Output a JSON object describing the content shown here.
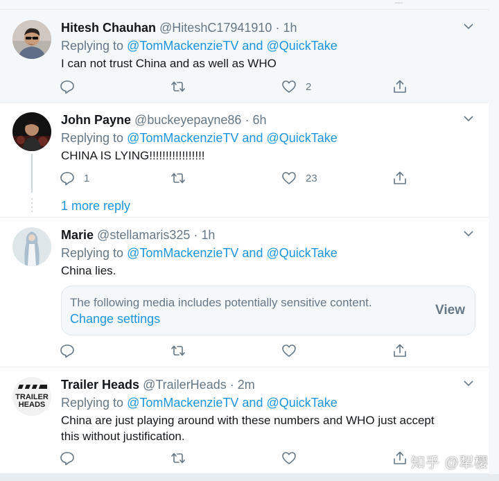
{
  "reply_prefix": "Replying to",
  "mention_1": "@TomMackenzieTV",
  "mention_join": "and",
  "mention_2": "@QuickTake",
  "header_sep": "·",
  "top_ghost": "—",
  "tweets": [
    {
      "name": "Hitesh Chauhan",
      "handle": "@HiteshC17941910",
      "time": "1h",
      "text": "I can not trust China and as well as WHO",
      "replies": "",
      "retweets": "",
      "likes": "2"
    },
    {
      "name": "John Payne",
      "handle": "@buckeyepayne86",
      "time": "6h",
      "text": "CHINA IS LYING!!!!!!!!!!!!!!!!!",
      "replies": "1",
      "retweets": "",
      "likes": "23"
    },
    {
      "name": "Marie",
      "handle": "@stellamaris325",
      "time": "1h",
      "text": "China lies.",
      "replies": "",
      "retweets": "",
      "likes": ""
    },
    {
      "name": "Trailer Heads",
      "handle": "@TrailerHeads",
      "time": "2m",
      "text": "China are just playing around with these numbers and WHO just accept this without justification.",
      "replies": "",
      "retweets": "",
      "likes": ""
    }
  ],
  "more_reply": "1 more reply",
  "sensitive": {
    "message": "The following media includes potentially sensitive content.",
    "change": "Change settings",
    "view": "View"
  },
  "trailer_logo": {
    "line1": "TRAILER",
    "line2": "HEADS"
  },
  "watermark": "知乎 @犁樱",
  "colors": {
    "accent": "#1b95e0",
    "muted": "#657786",
    "border": "#e6ecf0",
    "highlight_bg": "#f5f8fa"
  },
  "icons": [
    "reply-icon",
    "retweet-icon",
    "like-icon",
    "share-icon",
    "chevron-down-icon"
  ]
}
